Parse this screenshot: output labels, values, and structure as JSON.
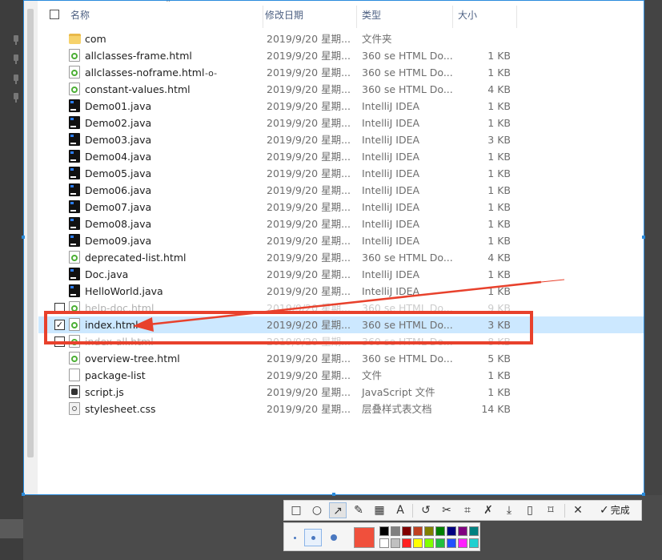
{
  "explorer": {
    "columns": {
      "name": "名称",
      "modified": "修改日期",
      "type": "类型",
      "size": "大小"
    },
    "files": [
      {
        "name": "com",
        "date": "2019/9/20 星期...",
        "type": "文件夹",
        "size": "",
        "icon": "folder-icon"
      },
      {
        "name": "allclasses-frame.html",
        "date": "2019/9/20 星期...",
        "type": "360 se HTML Do...",
        "size": "1 KB",
        "icon": "html-file-icon"
      },
      {
        "name": "allclasses-noframe.html",
        "date": "2019/9/20 星期...",
        "type": "360 se HTML Do...",
        "size": "1 KB",
        "icon": "html-file-icon"
      },
      {
        "name": "constant-values.html",
        "date": "2019/9/20 星期...",
        "type": "360 se HTML Do...",
        "size": "4 KB",
        "icon": "html-file-icon"
      },
      {
        "name": "Demo01.java",
        "date": "2019/9/20 星期...",
        "type": "IntelliJ IDEA",
        "size": "1 KB",
        "icon": "java-file-icon"
      },
      {
        "name": "Demo02.java",
        "date": "2019/9/20 星期...",
        "type": "IntelliJ IDEA",
        "size": "1 KB",
        "icon": "java-file-icon"
      },
      {
        "name": "Demo03.java",
        "date": "2019/9/20 星期...",
        "type": "IntelliJ IDEA",
        "size": "3 KB",
        "icon": "java-file-icon"
      },
      {
        "name": "Demo04.java",
        "date": "2019/9/20 星期...",
        "type": "IntelliJ IDEA",
        "size": "1 KB",
        "icon": "java-file-icon"
      },
      {
        "name": "Demo05.java",
        "date": "2019/9/20 星期...",
        "type": "IntelliJ IDEA",
        "size": "1 KB",
        "icon": "java-file-icon"
      },
      {
        "name": "Demo06.java",
        "date": "2019/9/20 星期...",
        "type": "IntelliJ IDEA",
        "size": "1 KB",
        "icon": "java-file-icon"
      },
      {
        "name": "Demo07.java",
        "date": "2019/9/20 星期...",
        "type": "IntelliJ IDEA",
        "size": "1 KB",
        "icon": "java-file-icon"
      },
      {
        "name": "Demo08.java",
        "date": "2019/9/20 星期...",
        "type": "IntelliJ IDEA",
        "size": "1 KB",
        "icon": "java-file-icon"
      },
      {
        "name": "Demo09.java",
        "date": "2019/9/20 星期...",
        "type": "IntelliJ IDEA",
        "size": "1 KB",
        "icon": "java-file-icon"
      },
      {
        "name": "deprecated-list.html",
        "date": "2019/9/20 星期...",
        "type": "360 se HTML Do...",
        "size": "4 KB",
        "icon": "html-file-icon"
      },
      {
        "name": "Doc.java",
        "date": "2019/9/20 星期...",
        "type": "IntelliJ IDEA",
        "size": "1 KB",
        "icon": "java-file-icon"
      },
      {
        "name": "HelloWorld.java",
        "date": "2019/9/20 星期...",
        "type": "IntelliJ IDEA",
        "size": "1 KB",
        "icon": "java-file-icon"
      },
      {
        "name": "help-doc.html",
        "date": "2019/9/20 星期...",
        "type": "360 se HTML Do...",
        "size": "9 KB",
        "icon": "html-file-icon",
        "state": "obscured"
      },
      {
        "name": "index.html",
        "date": "2019/9/20 星期...",
        "type": "360 se HTML Do...",
        "size": "3 KB",
        "icon": "html-file-icon",
        "state": "selected"
      },
      {
        "name": "index-all.html",
        "date": "2019/9/20 星期...",
        "type": "360 se HTML Do...",
        "size": "8 KB",
        "icon": "html-file-icon",
        "state": "obscured"
      },
      {
        "name": "overview-tree.html",
        "date": "2019/9/20 星期...",
        "type": "360 se HTML Do...",
        "size": "5 KB",
        "icon": "html-file-icon"
      },
      {
        "name": "package-list",
        "date": "2019/9/20 星期...",
        "type": "文件",
        "size": "1 KB",
        "icon": "generic-file-icon"
      },
      {
        "name": "script.js",
        "date": "2019/9/20 星期...",
        "type": "JavaScript 文件",
        "size": "1 KB",
        "icon": "js-file-icon"
      },
      {
        "name": "stylesheet.css",
        "date": "2019/9/20 星期...",
        "type": "层叠样式表文档",
        "size": "14 KB",
        "icon": "css-file-icon"
      }
    ]
  },
  "annotation": {
    "highlight_color": "#e8412c"
  },
  "toolbar": {
    "done_label": "完成",
    "icons": [
      "rectangle-icon",
      "ellipse-icon",
      "arrow-icon",
      "pencil-icon",
      "mosaic-icon",
      "text-icon",
      "undo-icon",
      "scissors-icon",
      "crop-icon",
      "pin-icon",
      "download-icon",
      "phone-icon",
      "bookmark-icon",
      "close-icon",
      "done-icon"
    ]
  },
  "palette": {
    "current_color": "#f0503c",
    "swatches_top": [
      "#000000",
      "#808080",
      "#800000",
      "#c04020",
      "#808000",
      "#008000",
      "#000080",
      "#800080",
      "#008080"
    ],
    "swatches_bottom": [
      "#ffffff",
      "#c0c0c0",
      "#ff2020",
      "#ffff00",
      "#80ff00",
      "#20c040",
      "#2050ff",
      "#ff20ff",
      "#20d0d0"
    ]
  }
}
